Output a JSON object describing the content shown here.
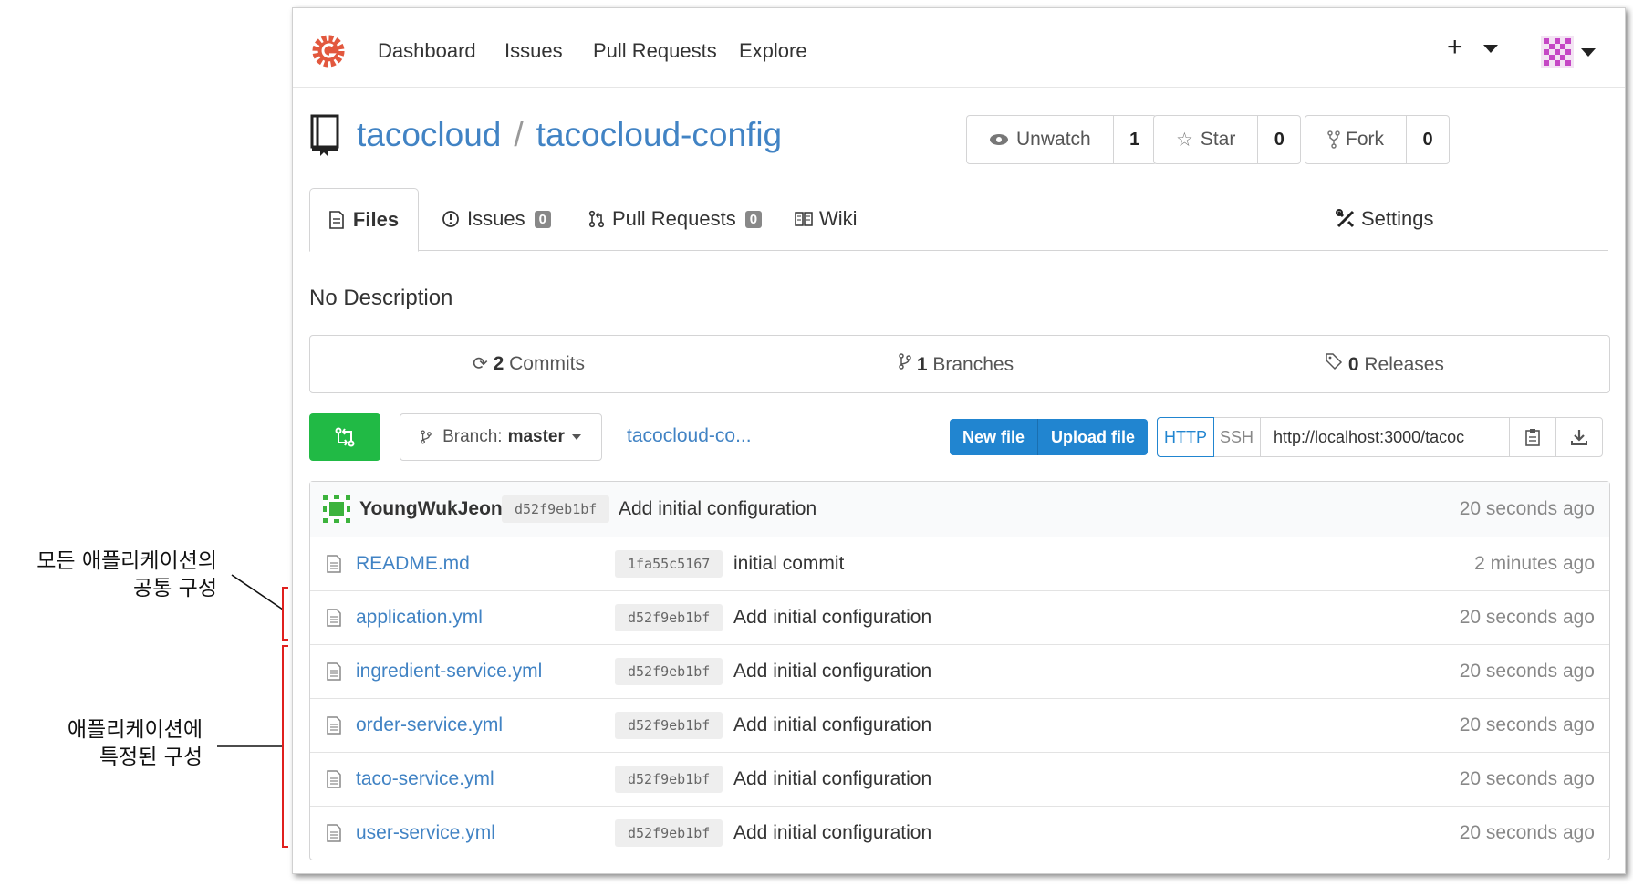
{
  "nav": {
    "items": [
      "Dashboard",
      "Issues",
      "Pull Requests",
      "Explore"
    ],
    "plus": "+"
  },
  "repo": {
    "owner": "tacocloud",
    "separator": "/",
    "name": "tacocloud-config",
    "watch_label": "Unwatch",
    "watch_count": "1",
    "star_label": "Star",
    "star_count": "0",
    "fork_label": "Fork",
    "fork_count": "0"
  },
  "tabs": {
    "files": "Files",
    "issues": "Issues",
    "issues_count": "0",
    "pulls": "Pull Requests",
    "pulls_count": "0",
    "wiki": "Wiki",
    "settings": "Settings"
  },
  "description": "No Description",
  "stats": {
    "commits_count": "2",
    "commits_label": "Commits",
    "branches_count": "1",
    "branches_label": "Branches",
    "releases_count": "0",
    "releases_label": "Releases"
  },
  "toolbar": {
    "branch_prefix": "Branch:",
    "branch_name": "master",
    "path": "tacocloud-co...",
    "new_file": "New file",
    "upload_file": "Upload file",
    "http": "HTTP",
    "ssh": "SSH",
    "clone_url": "http://localhost:3000/tacoc"
  },
  "latest_commit": {
    "author": "YoungWukJeon",
    "sha": "d52f9eb1bf",
    "message": "Add initial configuration",
    "age": "20 seconds ago"
  },
  "files": [
    {
      "name": "README.md",
      "sha": "1fa55c5167",
      "message": "initial commit",
      "age": "2 minutes ago"
    },
    {
      "name": "application.yml",
      "sha": "d52f9eb1bf",
      "message": "Add initial configuration",
      "age": "20 seconds ago"
    },
    {
      "name": "ingredient-service.yml",
      "sha": "d52f9eb1bf",
      "message": "Add initial configuration",
      "age": "20 seconds ago"
    },
    {
      "name": "order-service.yml",
      "sha": "d52f9eb1bf",
      "message": "Add initial configuration",
      "age": "20 seconds ago"
    },
    {
      "name": "taco-service.yml",
      "sha": "d52f9eb1bf",
      "message": "Add initial configuration",
      "age": "20 seconds ago"
    },
    {
      "name": "user-service.yml",
      "sha": "d52f9eb1bf",
      "message": "Add initial configuration",
      "age": "20 seconds ago"
    }
  ],
  "annotations": {
    "common_line1": "모든 애플리케이션의",
    "common_line2": "공통 구성",
    "specific_line1": "애플리케이션에",
    "specific_line2": "특정된 구성"
  },
  "colors": {
    "link": "#4183c4",
    "primary": "#2185d0",
    "green": "#21ba45",
    "annotation_red": "#e0201e",
    "logo": "#e2583e"
  }
}
